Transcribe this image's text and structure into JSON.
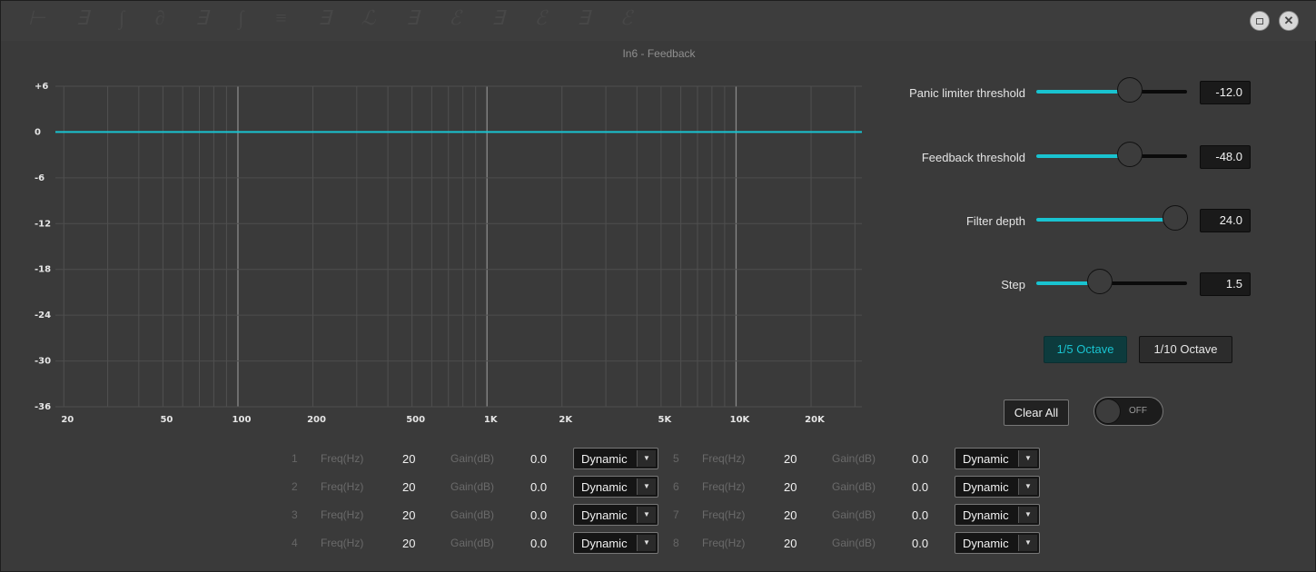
{
  "window": {
    "ghost_title": "⊢ ∃ ∫ ∂ ∃ ∫ ≡ ∃ ℒ ∃ ℰ ∃ ℰ ∃ ℰ",
    "panel_title": "In6 - Feedback"
  },
  "chart_data": {
    "type": "line",
    "y_ticks": [
      "+6",
      "0",
      "-6",
      "-12",
      "-18",
      "-24",
      "-30",
      "-36"
    ],
    "y_values": [
      6,
      0,
      -6,
      -12,
      -18,
      -24,
      -30,
      -36
    ],
    "ylim": [
      -36,
      6
    ],
    "x_ticks": [
      "20",
      "50",
      "100",
      "200",
      "500",
      "1K",
      "2K",
      "5K",
      "10K",
      "20K"
    ],
    "x_values": [
      20,
      50,
      100,
      200,
      500,
      1000,
      2000,
      5000,
      10000,
      20000
    ],
    "xlim": [
      20,
      20000
    ],
    "x_scale": "log",
    "grid": true,
    "series": [
      {
        "x": [
          20,
          20000
        ],
        "y": [
          0,
          0
        ],
        "color": "#19c3d0"
      }
    ]
  },
  "params": [
    {
      "label": "Panic limiter threshold",
      "value": "-12.0",
      "level": 0.62
    },
    {
      "label": "Feedback threshold",
      "value": "-48.0",
      "level": 0.62
    },
    {
      "label": "Filter depth",
      "value": "24.0",
      "level": 0.92
    },
    {
      "label": "Step",
      "value": "1.5",
      "level": 0.42
    }
  ],
  "octave": {
    "opt1": "1/5 Octave",
    "opt2": "1/10 Octave",
    "selected": "1/5 Octave"
  },
  "clear_all": "Clear All",
  "toggle": {
    "label": "OFF",
    "on": false
  },
  "filter_labels": {
    "freq": "Freq(Hz)",
    "gain": "Gain(dB)"
  },
  "filters": [
    {
      "num": "1",
      "freq": "20",
      "gain": "0.0",
      "mode": "Dynamic"
    },
    {
      "num": "2",
      "freq": "20",
      "gain": "0.0",
      "mode": "Dynamic"
    },
    {
      "num": "3",
      "freq": "20",
      "gain": "0.0",
      "mode": "Dynamic"
    },
    {
      "num": "4",
      "freq": "20",
      "gain": "0.0",
      "mode": "Dynamic"
    },
    {
      "num": "5",
      "freq": "20",
      "gain": "0.0",
      "mode": "Dynamic"
    },
    {
      "num": "6",
      "freq": "20",
      "gain": "0.0",
      "mode": "Dynamic"
    },
    {
      "num": "7",
      "freq": "20",
      "gain": "0.0",
      "mode": "Dynamic"
    },
    {
      "num": "8",
      "freq": "20",
      "gain": "0.0",
      "mode": "Dynamic"
    }
  ],
  "colors": {
    "accent": "#19c3d0",
    "background": "#3a3a3a"
  }
}
